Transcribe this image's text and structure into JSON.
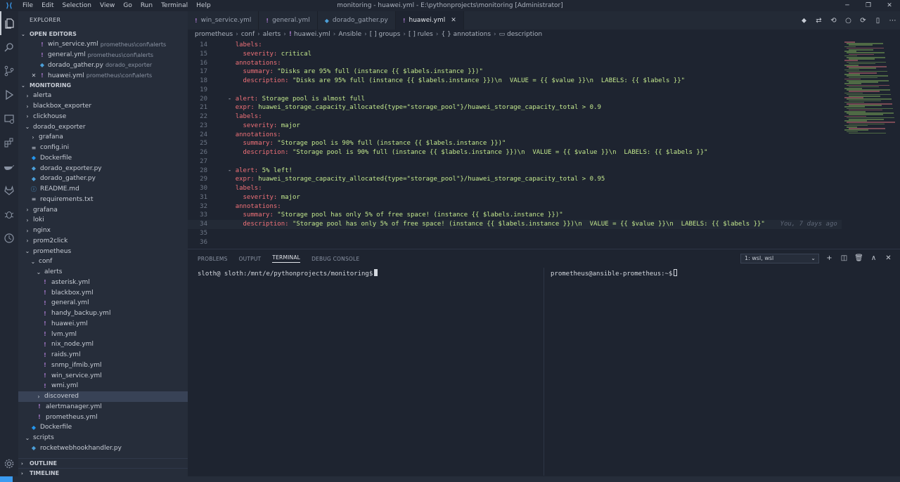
{
  "window": {
    "title": "monitoring - huawei.yml - E:\\pythonprojects\\monitoring [Administrator]",
    "menu": [
      "File",
      "Edit",
      "Selection",
      "View",
      "Go",
      "Run",
      "Terminal",
      "Help"
    ],
    "controls": [
      "─",
      "❐",
      "✕"
    ]
  },
  "activity": [
    "explorer-icon",
    "search-icon",
    "source-control-icon",
    "run-debug-icon",
    "remote-explorer-icon",
    "extensions-icon",
    "docker-icon",
    "gitlab-icon",
    "bug-icon",
    "timeline-icon",
    "gear-icon"
  ],
  "sidebar": {
    "title": "EXPLORER",
    "open_editors_label": "OPEN EDITORS",
    "open_editors": [
      {
        "name": "win_service.yml",
        "path": "prometheus\\conf\\alerts",
        "icon": "!",
        "kind": "yml",
        "close": ""
      },
      {
        "name": "general.yml",
        "path": "prometheus\\conf\\alerts",
        "icon": "!",
        "kind": "yml",
        "close": ""
      },
      {
        "name": "dorado_gather.py",
        "path": "dorado_exporter",
        "icon": "◆",
        "kind": "py",
        "close": ""
      },
      {
        "name": "huawei.yml",
        "path": "prometheus\\conf\\alerts",
        "icon": "!",
        "kind": "yml",
        "close": "✕"
      }
    ],
    "workspace_label": "MONITORING",
    "tree": [
      {
        "label": "alerta",
        "indent": 0,
        "chev": "›",
        "icon": "",
        "kind": ""
      },
      {
        "label": "blackbox_exporter",
        "indent": 0,
        "chev": "›",
        "icon": "",
        "kind": ""
      },
      {
        "label": "clickhouse",
        "indent": 0,
        "chev": "›",
        "icon": "",
        "kind": ""
      },
      {
        "label": "dorado_exporter",
        "indent": 0,
        "chev": "⌄",
        "icon": "",
        "kind": ""
      },
      {
        "label": "grafana",
        "indent": 1,
        "chev": "›",
        "icon": "",
        "kind": ""
      },
      {
        "label": "config.ini",
        "indent": 1,
        "chev": "",
        "icon": "≡",
        "kind": "txt"
      },
      {
        "label": "Dockerfile",
        "indent": 1,
        "chev": "",
        "icon": "◆",
        "kind": "docker"
      },
      {
        "label": "dorado_exporter.py",
        "indent": 1,
        "chev": "",
        "icon": "◆",
        "kind": "py"
      },
      {
        "label": "dorado_gather.py",
        "indent": 1,
        "chev": "",
        "icon": "◆",
        "kind": "py"
      },
      {
        "label": "README.md",
        "indent": 1,
        "chev": "",
        "icon": "ⓘ",
        "kind": "info"
      },
      {
        "label": "requirements.txt",
        "indent": 1,
        "chev": "",
        "icon": "≡",
        "kind": "txt"
      },
      {
        "label": "grafana",
        "indent": 0,
        "chev": "›",
        "icon": "",
        "kind": ""
      },
      {
        "label": "loki",
        "indent": 0,
        "chev": "›",
        "icon": "",
        "kind": ""
      },
      {
        "label": "nginx",
        "indent": 0,
        "chev": "›",
        "icon": "",
        "kind": ""
      },
      {
        "label": "prom2click",
        "indent": 0,
        "chev": "›",
        "icon": "",
        "kind": ""
      },
      {
        "label": "prometheus",
        "indent": 0,
        "chev": "⌄",
        "icon": "",
        "kind": ""
      },
      {
        "label": "conf",
        "indent": 1,
        "chev": "⌄",
        "icon": "",
        "kind": ""
      },
      {
        "label": "alerts",
        "indent": 2,
        "chev": "⌄",
        "icon": "",
        "kind": ""
      },
      {
        "label": "asterisk.yml",
        "indent": 3,
        "chev": "",
        "icon": "!",
        "kind": "yml"
      },
      {
        "label": "blackbox.yml",
        "indent": 3,
        "chev": "",
        "icon": "!",
        "kind": "yml"
      },
      {
        "label": "general.yml",
        "indent": 3,
        "chev": "",
        "icon": "!",
        "kind": "yml"
      },
      {
        "label": "handy_backup.yml",
        "indent": 3,
        "chev": "",
        "icon": "!",
        "kind": "yml"
      },
      {
        "label": "huawei.yml",
        "indent": 3,
        "chev": "",
        "icon": "!",
        "kind": "yml"
      },
      {
        "label": "lvm.yml",
        "indent": 3,
        "chev": "",
        "icon": "!",
        "kind": "yml"
      },
      {
        "label": "nix_node.yml",
        "indent": 3,
        "chev": "",
        "icon": "!",
        "kind": "yml"
      },
      {
        "label": "raids.yml",
        "indent": 3,
        "chev": "",
        "icon": "!",
        "kind": "yml"
      },
      {
        "label": "snmp_ifmib.yml",
        "indent": 3,
        "chev": "",
        "icon": "!",
        "kind": "yml"
      },
      {
        "label": "win_service.yml",
        "indent": 3,
        "chev": "",
        "icon": "!",
        "kind": "yml"
      },
      {
        "label": "wmi.yml",
        "indent": 3,
        "chev": "",
        "icon": "!",
        "kind": "yml"
      },
      {
        "label": "discovered",
        "indent": 2,
        "chev": "›",
        "icon": "",
        "kind": "",
        "selected": true
      },
      {
        "label": "alertmanager.yml",
        "indent": 2,
        "chev": "",
        "icon": "!",
        "kind": "yml"
      },
      {
        "label": "prometheus.yml",
        "indent": 2,
        "chev": "",
        "icon": "!",
        "kind": "yml"
      },
      {
        "label": "Dockerfile",
        "indent": 1,
        "chev": "",
        "icon": "◆",
        "kind": "docker"
      },
      {
        "label": "scripts",
        "indent": 0,
        "chev": "⌄",
        "icon": "",
        "kind": ""
      },
      {
        "label": "rocketwebhookhandler.py",
        "indent": 1,
        "chev": "",
        "icon": "◆",
        "kind": "py"
      }
    ],
    "outline_label": "OUTLINE",
    "timeline_label": "TIMELINE"
  },
  "tabs": [
    {
      "label": "win_service.yml",
      "icon": "!",
      "kind": "yml",
      "active": false
    },
    {
      "label": "general.yml",
      "icon": "!",
      "kind": "yml",
      "active": false
    },
    {
      "label": "dorado_gather.py",
      "icon": "◆",
      "kind": "py",
      "active": false
    },
    {
      "label": "huawei.yml",
      "icon": "!",
      "kind": "yml",
      "active": true,
      "close": "✕"
    }
  ],
  "editor_actions": [
    "⬥",
    "⇄",
    "⟲",
    "○",
    "⟳",
    "▯",
    "⋯"
  ],
  "breadcrumb": [
    "prometheus",
    "conf",
    "alerts",
    "huawei.yml",
    "Ansible",
    "[ ] groups",
    "[ ] rules",
    "{ } annotations",
    "▭ description"
  ],
  "code": [
    {
      "n": "14",
      "indent": "    ",
      "key": "labels:",
      "val": ""
    },
    {
      "n": "15",
      "indent": "      ",
      "key": "severity:",
      "val": " critical"
    },
    {
      "n": "16",
      "indent": "    ",
      "key": "annotations:",
      "val": ""
    },
    {
      "n": "17",
      "indent": "      ",
      "key": "summary:",
      "val": " \"Disks are 95% full (instance {{ $labels.instance }})\""
    },
    {
      "n": "18",
      "indent": "      ",
      "key": "description:",
      "val": " \"Disks are 95% full (instance {{ $labels.instance }})\\n  VALUE = {{ $value }}\\n  LABELS: {{ $labels }}\""
    },
    {
      "n": "19",
      "indent": "",
      "key": "",
      "val": ""
    },
    {
      "n": "20",
      "indent": "  - ",
      "key": "alert:",
      "val": " Storage pool is almost full"
    },
    {
      "n": "21",
      "indent": "    ",
      "key": "expr:",
      "val": " huawei_storage_capacity_allocated{type=\"storage_pool\"}/huawei_storage_capacity_total > 0.9"
    },
    {
      "n": "22",
      "indent": "    ",
      "key": "labels:",
      "val": ""
    },
    {
      "n": "23",
      "indent": "      ",
      "key": "severity:",
      "val": " major"
    },
    {
      "n": "24",
      "indent": "    ",
      "key": "annotations:",
      "val": ""
    },
    {
      "n": "25",
      "indent": "      ",
      "key": "summary:",
      "val": " \"Storage pool is 90% full (instance {{ $labels.instance }})\""
    },
    {
      "n": "26",
      "indent": "      ",
      "key": "description:",
      "val": " \"Storage pool is 90% full (instance {{ $labels.instance }})\\n  VALUE = {{ $value }}\\n  LABELS: {{ $labels }}\""
    },
    {
      "n": "27",
      "indent": "",
      "key": "",
      "val": ""
    },
    {
      "n": "28",
      "indent": "  - ",
      "key": "alert:",
      "val": " 5% left!"
    },
    {
      "n": "29",
      "indent": "    ",
      "key": "expr:",
      "val": " huawei_storage_capacity_allocated{type=\"storage_pool\"}/huawei_storage_capacity_total > 0.95"
    },
    {
      "n": "30",
      "indent": "    ",
      "key": "labels:",
      "val": ""
    },
    {
      "n": "31",
      "indent": "      ",
      "key": "severity:",
      "val": " major"
    },
    {
      "n": "32",
      "indent": "    ",
      "key": "annotations:",
      "val": ""
    },
    {
      "n": "33",
      "indent": "      ",
      "key": "summary:",
      "val": " \"Storage pool has only 5% of free space! (instance {{ $labels.instance }})\""
    },
    {
      "n": "34",
      "indent": "      ",
      "key": "description:",
      "val": " \"Storage pool has only 5% of free space! (instance {{ $labels.instance }})\\n  VALUE = {{ $value }}\\n  LABELS: {{ $labels }}\"",
      "blame": "    You, 7 days ago •",
      "current": true
    },
    {
      "n": "35",
      "indent": "",
      "key": "",
      "val": ""
    },
    {
      "n": "36",
      "indent": "",
      "key": "",
      "val": ""
    }
  ],
  "panel": {
    "tabs": [
      "PROBLEMS",
      "OUTPUT",
      "TERMINAL",
      "DEBUG CONSOLE"
    ],
    "active_tab": "TERMINAL",
    "terminal_select": "1: wsl, wsl",
    "actions": [
      "+",
      "◫",
      "🗑",
      "∧",
      "✕"
    ],
    "term_left": "sloth@ sloth:/mnt/e/pythonprojects/monitoring$",
    "term_right": "prometheus@ansible-prometheus:~$"
  },
  "colors": {
    "accent": "#3b9bf0",
    "yaml_key": "#f07178",
    "yaml_value": "#c3e88d",
    "bg": "#1e2430"
  }
}
